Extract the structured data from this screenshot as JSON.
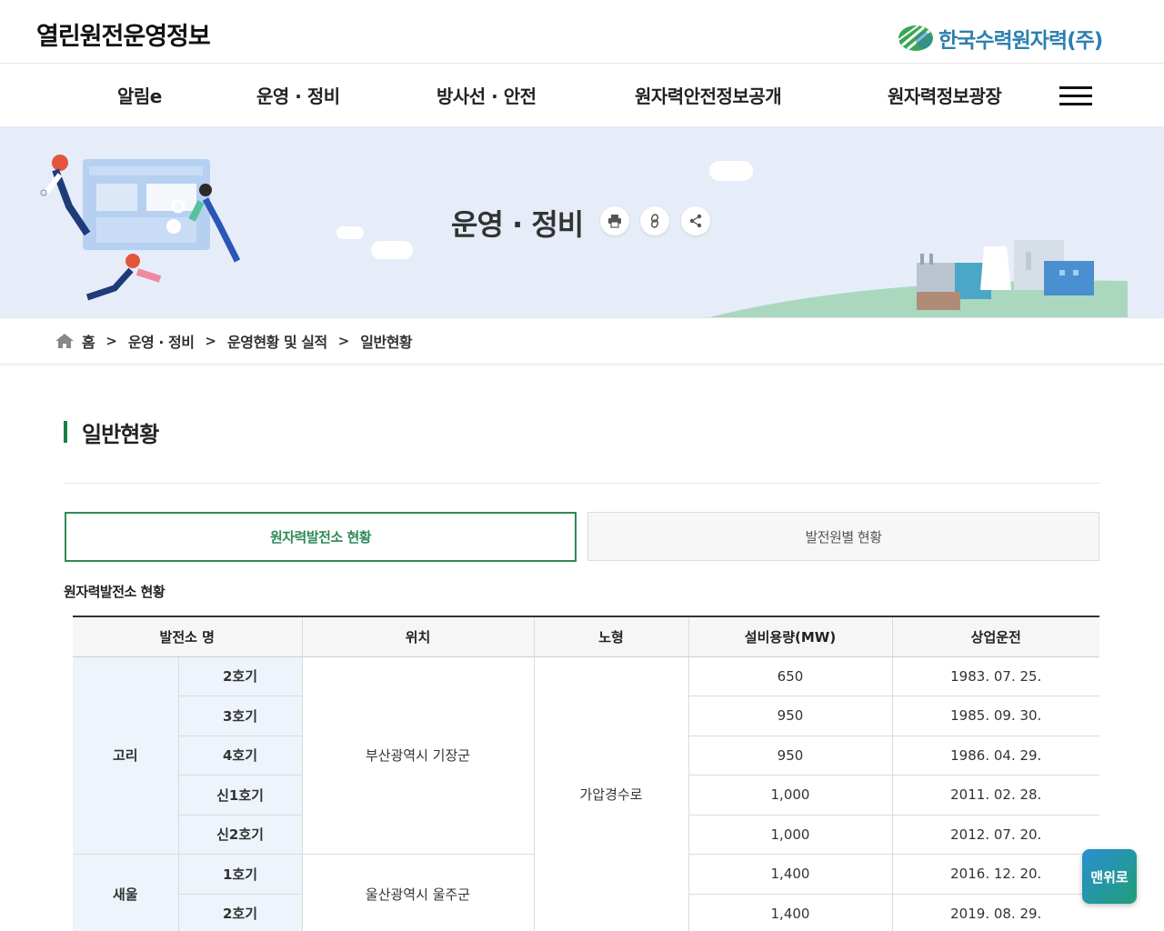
{
  "header": {
    "site_title": "열린원전운영정보",
    "brand_name": "한국수력원자력(주)",
    "brand_colors": {
      "green": "#4caf50",
      "blue": "#2e7fb0"
    }
  },
  "gnb": {
    "items": [
      {
        "label": "알림e"
      },
      {
        "label": "운영 · 정비"
      },
      {
        "label": "방사선 · 안전"
      },
      {
        "label": "원자력안전정보공개"
      },
      {
        "label": "원자력정보광장"
      }
    ],
    "menu_icon": "hamburger-icon"
  },
  "hero": {
    "title": "운영 · 정비",
    "buttons": [
      {
        "icon": "print-icon"
      },
      {
        "icon": "link-icon"
      },
      {
        "icon": "share-icon"
      }
    ],
    "background": "#e6edf9"
  },
  "breadcrumb": {
    "home_icon": "home-icon",
    "items": [
      "홈",
      "운영 · 정비",
      "운영현황 및 실적",
      "일반현황"
    ],
    "separator": ">"
  },
  "page": {
    "heading": "일반현황",
    "accent": "#1a7f46"
  },
  "tabs": [
    {
      "label": "원자력발전소 현황",
      "active": true
    },
    {
      "label": "발전원별 현황",
      "active": false
    }
  ],
  "table": {
    "caption": "원자력발전소 현황",
    "headers": [
      "발전소 명",
      "위치",
      "노형",
      "설비용량(MW)",
      "상업운전"
    ],
    "groups": [
      {
        "site": "고리",
        "location": "부산광역시 기장군",
        "units": [
          {
            "unit": "2호기",
            "capacity": "650",
            "date": "1983. 07. 25."
          },
          {
            "unit": "3호기",
            "capacity": "950",
            "date": "1985. 09. 30."
          },
          {
            "unit": "4호기",
            "capacity": "950",
            "date": "1986. 04. 29."
          },
          {
            "unit": "신1호기",
            "capacity": "1,000",
            "date": "2011. 02. 28."
          },
          {
            "unit": "신2호기",
            "capacity": "1,000",
            "date": "2012. 07. 20."
          }
        ]
      },
      {
        "site": "새울",
        "location": "울산광역시 울주군",
        "units": [
          {
            "unit": "1호기",
            "capacity": "1,400",
            "date": "2016. 12. 20."
          },
          {
            "unit": "2호기",
            "capacity": "1,400",
            "date": "2019. 08. 29."
          }
        ]
      }
    ],
    "reactor_type": "가압경수로"
  },
  "top_button": {
    "label": "맨위로"
  }
}
